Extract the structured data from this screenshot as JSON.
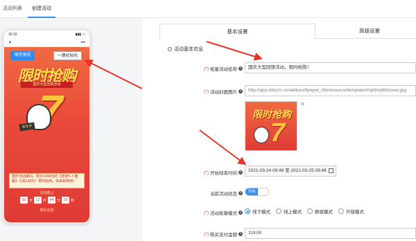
{
  "topbar": {
    "tabs": [
      {
        "label": "活动列表"
      },
      {
        "label": "创建活动"
      }
    ]
  },
  "phone": {
    "time": "15:10",
    "status_right": "▮▮▮ ▭",
    "nav_close": "✕",
    "nav_more": "•••",
    "save_preview_label": "保存预览",
    "init_label": "一键初始化",
    "poster_title": "限时抢购",
    "poster_subtitle": "国庆大型回馈活动",
    "badge": "周年庆",
    "desc": "国庆活动期间，原价1398元的【皇家5-人套餐】只需198元！限时抢购，快来抢购吧！",
    "end_label": "活动截止",
    "countdown": [
      "33",
      "12",
      "44",
      "33"
    ],
    "countdown_units": [
      "天",
      "时",
      "分",
      "秒"
    ],
    "foot": "剩余名额"
  },
  "tabs": {
    "basic": "基本设置",
    "advanced": "高级设置"
  },
  "section_title": "活动基本信息",
  "form": {
    "activity_name_label": "拓客活动名称",
    "activity_name_value": "国庆大型回馈活动，限时抢购！",
    "cover_label": "活动封面图片",
    "cover_value": "http://app.rkbcrm.cn/addons/fywywl_ztb/resource/template/tmp/tmp86/cover.jpg",
    "cover_close": "✕",
    "cover_title": "限时抢购",
    "time_label": "开始结束时间",
    "time_value": "2021-03-24 09:48 至 2021-03-25 09:48",
    "status_label": "当前活动状态",
    "status_on": "开启",
    "mode_label": "活动拓客模式",
    "modes": [
      {
        "label": "线下模式"
      },
      {
        "label": "线上模式"
      },
      {
        "label": "群组模式"
      },
      {
        "label": "外链模式"
      }
    ],
    "price_label": "购买支付金额",
    "price_value": "119.00",
    "req_mark": "(*)",
    "help": "?"
  },
  "colors": {
    "accent": "#3b8ee8",
    "arrow": "#e8332a",
    "required": "#ee3333"
  }
}
